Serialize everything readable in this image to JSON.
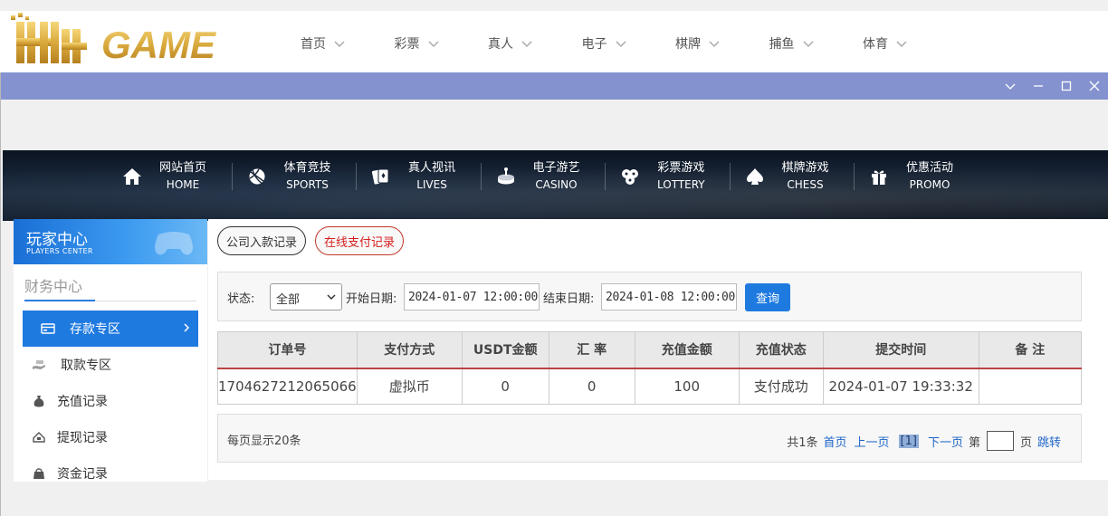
{
  "site": {
    "logo_text": "HH GAME",
    "nav": [
      {
        "label": "首页"
      },
      {
        "label": "彩票"
      },
      {
        "label": "真人"
      },
      {
        "label": "电子"
      },
      {
        "label": "棋牌"
      },
      {
        "label": "捕鱼"
      },
      {
        "label": "体育"
      }
    ]
  },
  "window": {
    "controls": [
      "chevron-down-icon",
      "minimize-icon",
      "maximize-icon",
      "close-icon"
    ]
  },
  "banner_nav": [
    {
      "zh": "网站首页",
      "en": "HOME",
      "icon": "home-icon"
    },
    {
      "zh": "体育竞技",
      "en": "SPORTS",
      "icon": "basketball-icon"
    },
    {
      "zh": "真人视讯",
      "en": "LIVES",
      "icon": "cards-icon"
    },
    {
      "zh": "电子游艺",
      "en": "CASINO",
      "icon": "slot-icon"
    },
    {
      "zh": "彩票游戏",
      "en": "LOTTERY",
      "icon": "lottery-balls-icon"
    },
    {
      "zh": "棋牌游戏",
      "en": "CHESS",
      "icon": "spade-icon"
    },
    {
      "zh": "优惠活动",
      "en": "PROMO",
      "icon": "gift-icon"
    }
  ],
  "side": {
    "header_zh": "玩家中心",
    "header_en": "PLAYERS CENTER",
    "section_title": "财务中心",
    "items": [
      {
        "label": "存款专区",
        "icon": "deposit-card-icon",
        "active": true
      },
      {
        "label": "取款专区",
        "icon": "withdraw-hand-icon"
      },
      {
        "label": "充值记录",
        "icon": "money-bag-icon"
      },
      {
        "label": "提现记录",
        "icon": "withdraw-record-icon"
      },
      {
        "label": "资金记录",
        "icon": "funds-icon"
      }
    ]
  },
  "main": {
    "tabs": [
      {
        "label": "公司入款记录",
        "active": false
      },
      {
        "label": "在线支付记录",
        "active": true
      }
    ],
    "filter": {
      "status_label": "状态:",
      "status_value": "全部",
      "start_label": "开始日期:",
      "start_value": "2024-01-07 12:00:00",
      "end_label": "结束日期:",
      "end_value": "2024-01-08 12:00:00",
      "query_label": "查询"
    },
    "table": {
      "headers": [
        "订单号",
        "支付方式",
        "USDT金额",
        "汇 率",
        "充值金额",
        "充值状态",
        "提交时间",
        "备 注"
      ],
      "rows": [
        [
          "1704627212065066",
          "虚拟币",
          "0",
          "0",
          "100",
          "支付成功",
          "2024-01-07 19:33:32",
          ""
        ]
      ]
    },
    "pager": {
      "per_page": "每页显示20条",
      "total": "共1条",
      "first": "首页",
      "prev": "上一页",
      "current": "[1]",
      "next": "下一页",
      "page_prefix": "第",
      "page_suffix": "页",
      "jump": "跳转"
    }
  }
}
